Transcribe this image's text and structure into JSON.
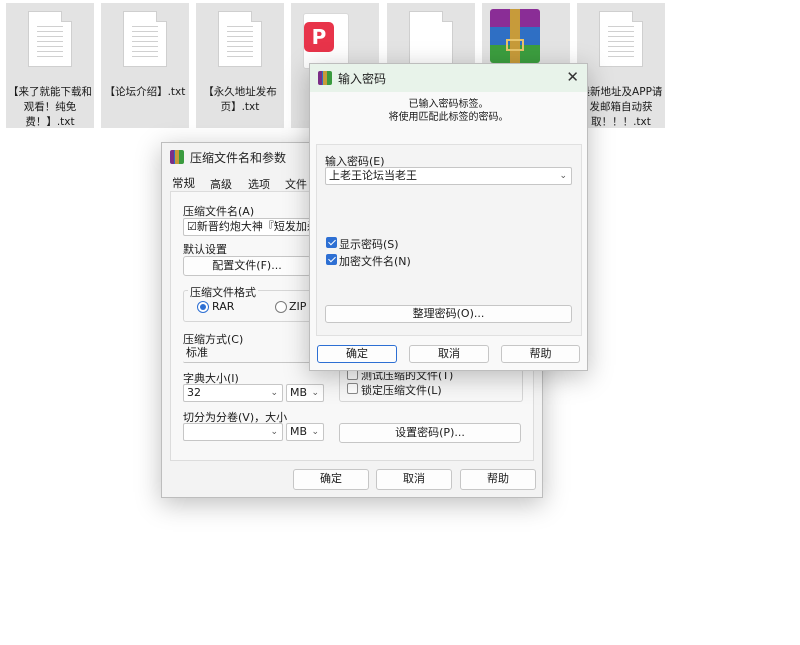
{
  "desktop": {
    "files": [
      {
        "label": "【来了就能下载和观看！纯免费！】.txt",
        "type": "txt"
      },
      {
        "label": "【论坛介绍】.txt",
        "type": "txt"
      },
      {
        "label": "【永久地址发布页】.txt",
        "type": "txt"
      },
      {
        "label": "",
        "type": "pdf"
      },
      {
        "label": "",
        "type": "blank"
      },
      {
        "label": "",
        "type": "winrar"
      },
      {
        "label": "最新地址及APP请发邮箱自动获取！！！.txt",
        "type": "txt"
      }
    ]
  },
  "archive_dialog": {
    "title": "压缩文件名和参数",
    "tabs": [
      "常规",
      "高级",
      "选项",
      "文件"
    ],
    "archive_name_label": "压缩文件名(A)",
    "archive_name_value": "☑新晋约炮大神『短发加杀』1",
    "default_settings_label": "默认设置",
    "profile_button": "配置文件(F)...",
    "format_label": "压缩文件格式",
    "format_rar": "RAR",
    "format_zip": "ZIP",
    "method_label": "压缩方式(C)",
    "method_value": "标准",
    "dict_label": "字典大小(I)",
    "dict_value": "32",
    "dict_unit": "MB",
    "split_label": "切分为分卷(V)，大小",
    "split_value": "",
    "split_unit": "MB",
    "test_files_label": "测试压缩的文件(T)",
    "lock_archive_label": "锁定压缩文件(L)",
    "set_password_button": "设置密码(P)...",
    "ok": "确定",
    "cancel": "取消",
    "help": "帮助"
  },
  "password_dialog": {
    "title": "输入密码",
    "info_line1": "已输入密码标签。",
    "info_line2": "将使用匹配此标签的密码。",
    "password_label": "输入密码(E)",
    "password_value": "上老王论坛当老王",
    "show_password_label": "显示密码(S)",
    "show_password_checked": true,
    "encrypt_names_label": "加密文件名(N)",
    "encrypt_names_checked": true,
    "organize_button": "整理密码(O)...",
    "ok": "确定",
    "cancel": "取消",
    "help": "帮助"
  }
}
